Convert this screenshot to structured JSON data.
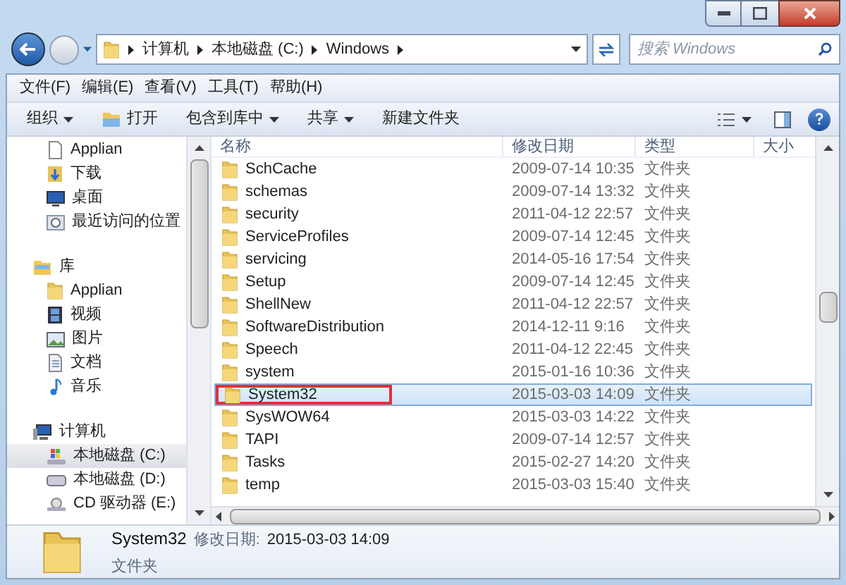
{
  "breadcrumb": [
    "计算机",
    "本地磁盘 (C:)",
    "Windows"
  ],
  "search": {
    "placeholder": "搜索 Windows"
  },
  "menu": [
    "文件(F)",
    "编辑(E)",
    "查看(V)",
    "工具(T)",
    "帮助(H)"
  ],
  "toolbar": [
    {
      "label": "组织",
      "kind": "dropdown"
    },
    {
      "label": "打开",
      "kind": "open"
    },
    {
      "label": "包含到库中",
      "kind": "dropdown"
    },
    {
      "label": "共享",
      "kind": "dropdown"
    },
    {
      "label": "新建文件夹",
      "kind": "plain"
    }
  ],
  "sidebar": [
    {
      "label": "Applian",
      "kind": "file",
      "selected": false
    },
    {
      "label": "下载",
      "kind": "download",
      "selected": false
    },
    {
      "label": "桌面",
      "kind": "desktop",
      "selected": false
    },
    {
      "label": "最近访问的位置",
      "kind": "recent",
      "selected": false
    },
    {
      "label": "库",
      "kind": "library",
      "selected": false
    },
    {
      "label": "Applian",
      "kind": "folder",
      "selected": false
    },
    {
      "label": "视频",
      "kind": "video",
      "selected": false
    },
    {
      "label": "图片",
      "kind": "picture",
      "selected": false
    },
    {
      "label": "文档",
      "kind": "document",
      "selected": false
    },
    {
      "label": "音乐",
      "kind": "music",
      "selected": false
    },
    {
      "label": "计算机",
      "kind": "computer",
      "selected": false
    },
    {
      "label": "本地磁盘 (C:)",
      "kind": "systemdrive",
      "selected": true
    },
    {
      "label": "本地磁盘 (D:)",
      "kind": "drive",
      "selected": false
    },
    {
      "label": "CD 驱动器 (E:)",
      "kind": "cd",
      "selected": false
    }
  ],
  "table": {
    "columns": [
      "名称",
      "修改日期",
      "类型",
      "大小"
    ],
    "rows": [
      {
        "name": "SchCache",
        "date": "2009-07-14 10:35",
        "type": "文件夹",
        "selected": false
      },
      {
        "name": "schemas",
        "date": "2009-07-14 13:32",
        "type": "文件夹",
        "selected": false
      },
      {
        "name": "security",
        "date": "2011-04-12 22:57",
        "type": "文件夹",
        "selected": false
      },
      {
        "name": "ServiceProfiles",
        "date": "2009-07-14 12:45",
        "type": "文件夹",
        "selected": false
      },
      {
        "name": "servicing",
        "date": "2014-05-16 17:54",
        "type": "文件夹",
        "selected": false
      },
      {
        "name": "Setup",
        "date": "2009-07-14 12:45",
        "type": "文件夹",
        "selected": false
      },
      {
        "name": "ShellNew",
        "date": "2011-04-12 22:57",
        "type": "文件夹",
        "selected": false
      },
      {
        "name": "SoftwareDistribution",
        "date": "2014-12-11 9:16",
        "type": "文件夹",
        "selected": false
      },
      {
        "name": "Speech",
        "date": "2011-04-12 22:45",
        "type": "文件夹",
        "selected": false
      },
      {
        "name": "system",
        "date": "2015-01-16 10:36",
        "type": "文件夹",
        "selected": false
      },
      {
        "name": "System32",
        "date": "2015-03-03 14:09",
        "type": "文件夹",
        "selected": true
      },
      {
        "name": "SysWOW64",
        "date": "2015-03-03 14:22",
        "type": "文件夹",
        "selected": false
      },
      {
        "name": "TAPI",
        "date": "2009-07-14 12:57",
        "type": "文件夹",
        "selected": false
      },
      {
        "name": "Tasks",
        "date": "2015-02-27 14:20",
        "type": "文件夹",
        "selected": false
      },
      {
        "name": "temp",
        "date": "2015-03-03 15:40",
        "type": "文件夹",
        "selected": false
      }
    ]
  },
  "details": {
    "name": "System32",
    "date_label": "修改日期:",
    "date": "2015-03-03 14:09",
    "type": "文件夹"
  }
}
